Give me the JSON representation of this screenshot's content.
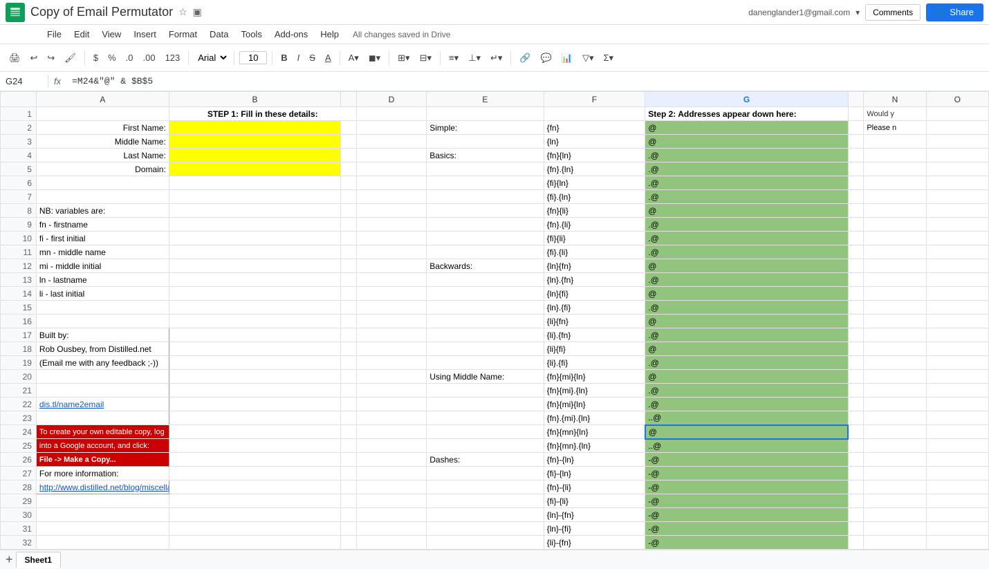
{
  "app": {
    "icon_color": "#0f9d58",
    "title": "Copy of Email Permutator",
    "user_email": "danenglander1@gmail.com",
    "autosave": "All changes saved in Drive",
    "comments_label": "Comments",
    "share_label": "Share"
  },
  "menu": {
    "items": [
      "File",
      "Edit",
      "View",
      "Insert",
      "Format",
      "Data",
      "Tools",
      "Add-ons",
      "Help"
    ]
  },
  "toolbar": {
    "font": "Arial",
    "font_size": "10"
  },
  "formula_bar": {
    "cell_ref": "G24",
    "formula": "=M24&\"@\" & $B$5"
  },
  "columns": [
    "A",
    "B",
    "D",
    "E",
    "F",
    "G",
    "N",
    "O"
  ],
  "sheet": {
    "step1_header": "STEP 1: Fill in these details:",
    "step2_header": "Step 2: Addresses appear down here:",
    "rows": {
      "r2": {
        "label": "First Name:",
        "simple_label": "Simple:",
        "f_val": "{fn}",
        "g_val": "@"
      },
      "r3": {
        "label": "Middle Name:",
        "f_val": "{ln}",
        "g_val": "@"
      },
      "r4": {
        "label": "Last Name:",
        "basics_label": "Basics:",
        "f_val": "{fn}{ln}",
        "g_val": ".@"
      },
      "r5": {
        "label": "Domain:",
        "f_val": "{fn}.{ln}",
        "g_val": ".@"
      },
      "r6": {
        "f_val": "{fi}{ln}",
        "g_val": ".@"
      },
      "r7": {
        "f_val": "{fi}.{ln}",
        "g_val": ".@"
      },
      "r8": {
        "nb_label": "NB: variables are:",
        "f_val": "{fn}{li}",
        "g_val": "@"
      },
      "r9": {
        "nb_label": "fn - firstname",
        "f_val": "{fn}.{li}",
        "g_val": ".@"
      },
      "r10": {
        "nb_label": "fi - first initial",
        "f_val": "{fi}{li}",
        "g_val": ".@"
      },
      "r11": {
        "nb_label": "mn - middle name",
        "f_val": "{fi}.{li}",
        "g_val": ".@"
      },
      "r12": {
        "nb_label": "mi - middle initial",
        "backwards_label": "Backwards:",
        "f_val": "{ln}{fn}",
        "g_val": "@"
      },
      "r13": {
        "nb_label": "ln - lastname",
        "f_val": "{ln}.{fn}",
        "g_val": ".@"
      },
      "r14": {
        "nb_label": "li - last initial",
        "f_val": "{ln}{fi}",
        "g_val": "@"
      },
      "r15": {
        "f_val": "{ln}.{fi}",
        "g_val": ".@"
      },
      "r16": {
        "f_val": "{li}{fn}",
        "g_val": "@"
      },
      "r17": {
        "built_label": "Built by:",
        "f_val": "{li}.{fn}",
        "g_val": ".@"
      },
      "r18": {
        "built_label": "Rob Ousbey, from Distilled.net",
        "f_val": "{li}{fi}",
        "g_val": "@"
      },
      "r19": {
        "built_label": "(Email me with any feedback ;-))",
        "f_val": "{li}.{fi}",
        "g_val": ".@"
      },
      "r20": {
        "using_label": "Using Middle Name:",
        "f_val": "{fn}{mi}{ln}",
        "g_val": "@"
      },
      "r21": {
        "f_val": "{fn}{mi}.{ln}",
        "g_val": ".@"
      },
      "r22": {
        "link_label": "dis.tl/name2email",
        "f_val": "{fn}{mi}{ln}",
        "g_val": ".@"
      },
      "r23": {
        "f_val": "{fn}.{mi}.{ln}",
        "g_val": "..@"
      },
      "r24": {
        "red1": "To create your own editable copy, log",
        "f_val": "{fn}{mn}{ln}",
        "g_val": "@",
        "selected": true
      },
      "r25": {
        "red2": "into a Google account, and click:",
        "f_val": "{fn}{mn}.{ln}",
        "g_val": "..@"
      },
      "r26": {
        "red3": "File -> Make a Copy...",
        "dashes_label": "Dashes:",
        "f_val": "{fn}-{ln}",
        "g_val": "-@"
      },
      "r27": {
        "for_label": "For more information:",
        "f_val": "{fi}-{ln}",
        "g_val": "-@"
      },
      "r28": {
        "link2": "http://www.distilled.net/blog/miscellaneous",
        "f_val": "{fn}-{li}",
        "g_val": "-@"
      },
      "r29": {
        "f_val": "{fi}-{li}",
        "g_val": "-@"
      },
      "r30": {
        "f_val": "{ln}-{fn}",
        "g_val": "-@"
      },
      "r31": {
        "f_val": "{ln}-{fi}",
        "g_val": "-@"
      },
      "r32": {
        "f_val": "{li}-{fn}",
        "g_val": "-@"
      }
    },
    "would_please": "Would y\nPlease n"
  }
}
